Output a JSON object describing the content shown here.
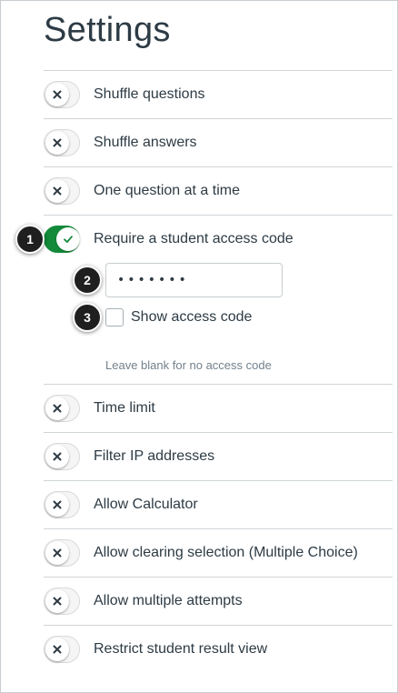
{
  "page": {
    "title": "Settings"
  },
  "settings": [
    {
      "label": "Shuffle questions",
      "enabled": false
    },
    {
      "label": "Shuffle answers",
      "enabled": false
    },
    {
      "label": "One question at a time",
      "enabled": false
    },
    {
      "label": "Require a student access code",
      "enabled": true
    },
    {
      "label": "Time limit",
      "enabled": false
    },
    {
      "label": "Filter IP addresses",
      "enabled": false
    },
    {
      "label": "Allow Calculator",
      "enabled": false
    },
    {
      "label": "Allow clearing selection (Multiple Choice)",
      "enabled": false
    },
    {
      "label": "Allow multiple attempts",
      "enabled": false
    },
    {
      "label": "Restrict student result view",
      "enabled": false
    }
  ],
  "access_code": {
    "value": "•••••••",
    "show_label": "Show access code",
    "show_checked": false,
    "hint": "Leave blank for no access code"
  },
  "callouts": [
    "1",
    "2",
    "3"
  ],
  "icons": {
    "off": "x-icon",
    "on": "check-icon"
  },
  "colors": {
    "toggle_on": "#128a3a",
    "text": "#2d3b45",
    "hint": "#73818c"
  }
}
